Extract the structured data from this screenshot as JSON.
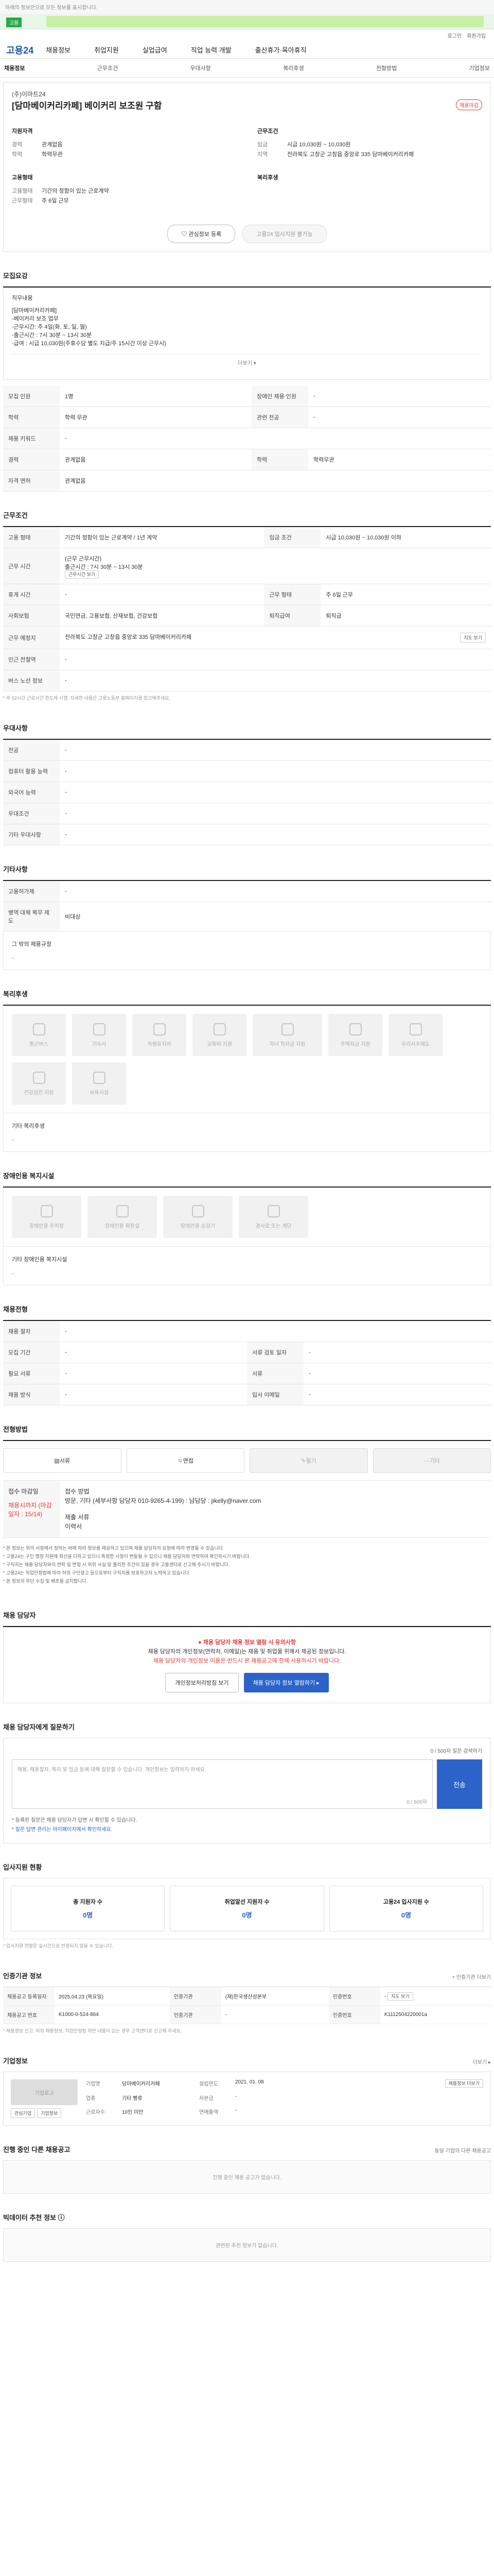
{
  "top_notice": "아래의 정보만으로 모든 정보를 표시합니다.",
  "search": {
    "tag": "고용"
  },
  "util": {
    "login": "로그인",
    "join": "회원가입"
  },
  "logo": "고용24",
  "gnb": [
    "채용정보",
    "취업지원",
    "실업급여",
    "직업 능력 개발",
    "출산휴가·육아휴직"
  ],
  "subnav": [
    "채용정보",
    "근무조건",
    "우대사항",
    "복리후생",
    "전형방법",
    "기업정보"
  ],
  "summary": {
    "company": "(주)이마트24",
    "title": "[담마베이커리카페] 베이커리 보조원 구함",
    "badge": "채용마감",
    "left_head": "지원자격",
    "left": [
      {
        "k": "경력",
        "v": "관계없음"
      },
      {
        "k": "학력",
        "v": "학력무관"
      }
    ],
    "left2_head": "고용형태",
    "left2": [
      {
        "k": "고용형태",
        "v": "기간의 정함이 있는 근로계약"
      },
      {
        "k": "근무형태",
        "v": "주 6일 근무"
      }
    ],
    "right_head": "근무조건",
    "right": [
      {
        "k": "임금",
        "v": "시급 10,030원 ~ 10,030원"
      },
      {
        "k": "지역",
        "v": "전라북도 고창군 고창읍 중앙로 335 담마베이커리카페"
      }
    ],
    "right2_head": "복리후생",
    "btn_fav": "관심정보 등록",
    "btn_apply": "고용24 입사지원 불가능"
  },
  "recruit": {
    "title": "모집요강",
    "desc": [
      "직무내용",
      "[담마베이커리카페]",
      "-베이커리 보조 업무",
      "-근무시간: 주 4일(화, 토, 일, 월)",
      "-출근시간 : 7시 30분 ~ 13시 30분",
      "-급여 : 시급 10,030원(주휴수당 별도 지급/주 15시간 이상 근무시)"
    ],
    "more": "더보기 ▾",
    "rows": [
      {
        "k": "모집 인원",
        "v": "1명",
        "k2": "장애인 채용 인원",
        "v2": "-"
      },
      {
        "k": "학력",
        "v": "학력 무관",
        "k2": "관련 전공",
        "v2": "-"
      },
      {
        "k": "채용 키워드",
        "v": "-",
        "k2": "",
        "v2": ""
      },
      {
        "k": "경력",
        "v": "관계없음",
        "k2": "학력",
        "v2": "학력무관"
      },
      {
        "k": "자격 면허",
        "v": "관계없음",
        "k2": "",
        "v2": ""
      }
    ]
  },
  "work": {
    "title": "근무조건",
    "rows": [
      {
        "k": "고용 형태",
        "v": "기간의 정함이 있는 근로계약 / 1년 계약",
        "k2": "임금 조건",
        "v2": "시급 10,030원 ~ 10,030원 이하"
      },
      {
        "k": "근무 시간",
        "v": "(근무 근무시간)",
        "k2": "",
        "v2": ""
      },
      {
        "k": "휴게 시간",
        "v": "-",
        "k2": "근무 형태",
        "v2": "주 6일 근무"
      },
      {
        "k": "사회보험",
        "v": "국민연금, 고용보험, 산재보험, 건강보험",
        "k2": "퇴직급여",
        "v2": "퇴직금"
      },
      {
        "k": "근무 예정지",
        "v": "전라북도 고창군 고창읍 중앙로 335 담마베이커리카페",
        "k2": "",
        "v2": ""
      },
      {
        "k": "인근 전철역",
        "v": "-",
        "k2": "",
        "v2": ""
      },
      {
        "k": "버스 노선 정보",
        "v": "-",
        "k2": "",
        "v2": ""
      }
    ],
    "time_line": "출근시간 : 7시 30분 ~ 13시 30분",
    "time_tag": "근무시간 보기",
    "map_btn": "지도 보기",
    "note": "* 주 52시간 근로시간 한도제 시행. 자세한 내용은 고용노동부 홈페이지를 참고해주세요."
  },
  "prefer": {
    "title": "우대사항",
    "rows": [
      {
        "k": "전공",
        "v": "-"
      },
      {
        "k": "컴퓨터 활용 능력",
        "v": "-"
      },
      {
        "k": "외국어 능력",
        "v": "-"
      },
      {
        "k": "우대조건",
        "v": "-"
      },
      {
        "k": "기타 우대사항",
        "v": "-"
      }
    ]
  },
  "etc": {
    "title": "기타사항",
    "rows": [
      {
        "k": "고용허가제",
        "v": "-"
      },
      {
        "k": "병역 대체 복무 제도",
        "v": "비대상"
      }
    ],
    "sub": "그 밖의 채용규정",
    "sub_val": "-"
  },
  "welfare": {
    "title": "복리후생",
    "items": [
      "통근버스",
      "기숙사",
      "차량유지비",
      "교육비 지원",
      "자녀 학자금 지원",
      "주택자금 지원",
      "우리사주제도",
      "건강검진 지원",
      "보육시설"
    ],
    "sub": "기타 복리후생",
    "sub_val": "-"
  },
  "disabled": {
    "title": "장애인용 복지시설",
    "items": [
      "장애인용 주차장",
      "장애인용 화장실",
      "장애인용 승강기",
      "경사로 또는 계단"
    ],
    "sub": "기타 장애인용 복지시설",
    "sub_val": "-"
  },
  "process": {
    "title": "채용전형",
    "rows": [
      {
        "k": "채용 절차",
        "v": "-",
        "k2": "",
        "v2": ""
      },
      {
        "k": "모집 기간",
        "v": "-",
        "k2": "서류 검토 일자",
        "v2": "-"
      },
      {
        "k": "필요 서류",
        "v": "-",
        "k2": "서류",
        "v2": "-"
      },
      {
        "k": "채용 방식",
        "v": "-",
        "k2": "입사 이메일",
        "v2": "-"
      }
    ]
  },
  "apply": {
    "title": "전형방법",
    "methods": [
      {
        "label": "서류",
        "on": true
      },
      {
        "label": "면접",
        "on": true
      },
      {
        "label": "필기",
        "on": false
      },
      {
        "label": "기타",
        "on": false
      }
    ],
    "lbl": "접수 마감일",
    "deadline": "채용시까지 (마감일자 : 15/14)",
    "method_label": "접수 방법",
    "method_val": "방문, 기타 (세부사항 담당자 010-9265-4-199) : 남담당 : jikelly@naver.com",
    "docs_label": "제출 서류",
    "docs_val": "이력서",
    "caution": [
      "* 본 정보는 위의 사항에서 정하는 바에 따라 정보를 제공하고 있으며 채용 담당자의 요청에 따라 변경될 수 있습니다.",
      "* 고용24는 구인 행정 지원에 최선을 다하고 있으나 특정한 사항이 변동될 수 있으니 채용 담당자와 연락하여 확인하시기 바랍니다.",
      "* 구직자는 채용 담당자와의 연락 및 면접 시 허위 사실 및 불리한 조건이 있을 경우 고용센터로 신고해 주시기 바랍니다.",
      "* 고용24는 직업안정법에 따라 허위 구인광고 등으로부터 구직자를 보호하고자 노력하고 있습니다.",
      "* 본 정보의 무단 수집 및 배포를 금지합니다."
    ]
  },
  "contact": {
    "title": "채용 담당자",
    "warn": "채용 담당자 채용 정보 열람 시 유의사항",
    "body1": "채용 담당자의 개인정보(연락처, 이메일)는 채용 및 취업을 위해서 제공된 정보입니다.",
    "body2": "채용 담당자의 개인정보 이용은 반드시 본 채용공고에 한해 사용하시기 바랍니다.",
    "btn1": "개인정보처리방침 보기",
    "btn2": "채용 담당자 정보 열람하기 ▸"
  },
  "qa": {
    "title": "채용 담당자에게 질문하기",
    "right": "0 / 500자 질문 검색하기",
    "placeholder": "채용, 채용절차, 복리 및 임금 등에 대해 질문할 수 있습니다. 개인정보는 입력하지 마세요.",
    "counter": "0 / 500자",
    "btn": "전송",
    "foot1": "* 등록된 질문은 채용 담당자가 답변 시 확인할 수 있습니다.",
    "foot2": "* 질문 답변 관리는 마이페이지에서 확인하세요."
  },
  "stats": {
    "title": "입사지원 현황",
    "items": [
      {
        "l": "총 지원자 수",
        "v": "0명"
      },
      {
        "l": "취업알선 지원자 수",
        "v": "0명"
      },
      {
        "l": "고용24 입사지원 수",
        "v": "0명"
      }
    ],
    "note": "* 입사지원 현황은 실시간으로 반영되지 않을 수 있습니다."
  },
  "info": {
    "title": "인증기관 정보",
    "right": "+ 인증기관 더보기",
    "rows": [
      {
        "k": "채용공고 등록일자",
        "v": "2025.04.23 (목요일)",
        "k2": "인증기관",
        "v2": "(재)한국생산성본부",
        "k3": "인증번호",
        "v3": "-"
      },
      {
        "k": "채용공고 번호",
        "v": "K1000-0-524-864",
        "k2": "인증기관",
        "v2": "-",
        "k3": "인증번호",
        "v3": "K1112504220001a"
      }
    ],
    "btn": "지도 보기",
    "note": "* 채용정보 신고: 허위 채용정보, 직업안정법 위반 내용이 있는 경우 고객센터로 신고해 주세요."
  },
  "corp": {
    "title": "기업정보",
    "right": "더보기 ▸",
    "logo": "기업로고",
    "pills": [
      "관심기업",
      "기업정보"
    ],
    "rows": [
      {
        "k": "기업명",
        "v": "담마베이커리카페"
      },
      {
        "k": "설립연도",
        "v": "2021. 01. 08"
      },
      {
        "k": "업종",
        "v": "기타 빵류"
      },
      {
        "k": "자본금",
        "v": "-"
      },
      {
        "k": "근로자수",
        "v": "10인 미만"
      },
      {
        "k": "연매출액",
        "v": "-"
      }
    ],
    "badge": "채용정보 더보기"
  },
  "other": {
    "title": "진행 중인 다른 채용공고",
    "right": "동일 기업의 다른 채용공고",
    "empty": "진행 중인 채용 공고가 없습니다."
  },
  "rec": {
    "title": "빅데이터 추천 정보",
    "empty": "관련된 추천 정보가 없습니다."
  }
}
